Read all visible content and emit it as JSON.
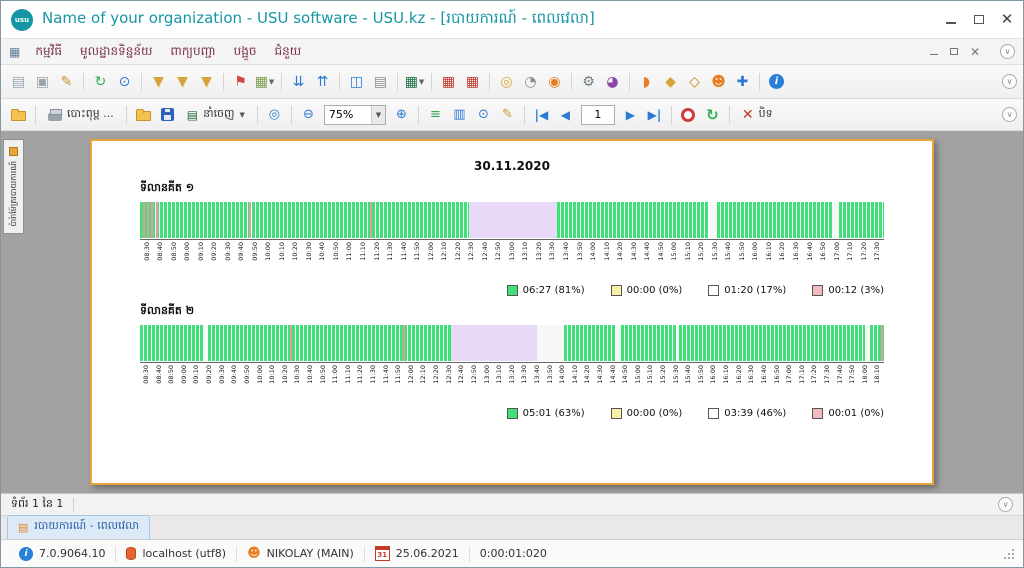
{
  "window": {
    "logo_text": "usu",
    "title": "Name of your organization - USU software - USU.kz - [របាយការណ៍ - ពេលវេលា]"
  },
  "menu": {
    "items": [
      "កម្មវិធី",
      "មូលដ្ឋានទិន្នន័យ",
      "ពាក្យបញ្ជា",
      "បង្អួច",
      "ជំនួយ"
    ]
  },
  "toolbar_main": {
    "icons": [
      {
        "name": "new-record-icon",
        "glyph": "▤",
        "color": "#98a4ae"
      },
      {
        "name": "copy-record-icon",
        "glyph": "▣",
        "color": "#98a4ae"
      },
      {
        "name": "edit-record-icon",
        "glyph": "✎",
        "color": "#c8952e"
      },
      {
        "sep": true
      },
      {
        "name": "refresh-data-icon",
        "glyph": "↻",
        "color": "#2faf4f"
      },
      {
        "name": "search-icon",
        "glyph": "⊙",
        "color": "#2b7bd5"
      },
      {
        "sep": true
      },
      {
        "name": "filter-icon",
        "glyph": "▼",
        "color": "#d5a33a"
      },
      {
        "name": "filter-add-icon",
        "glyph": "▼",
        "color": "#d5a33a"
      },
      {
        "name": "filter-clear-icon",
        "glyph": "▼",
        "color": "#d5a33a"
      },
      {
        "sep": true
      },
      {
        "name": "flag-icon",
        "glyph": "⚑",
        "color": "#d04545"
      },
      {
        "name": "image-icon",
        "glyph": "▦",
        "color": "#7a9e4f",
        "dropdown": true
      },
      {
        "sep": true
      },
      {
        "name": "expand-all-icon",
        "glyph": "⇊",
        "color": "#2b7bd5"
      },
      {
        "name": "collapse-all-icon",
        "glyph": "⇈",
        "color": "#2b7bd5"
      },
      {
        "sep": true
      },
      {
        "name": "add-tab-icon",
        "glyph": "◫",
        "color": "#2b7bd5"
      },
      {
        "name": "notebook-icon",
        "glyph": "▤",
        "color": "#8a8f94"
      },
      {
        "sep": true
      },
      {
        "name": "excel-export-icon",
        "glyph": "▦",
        "color": "#1d7044",
        "dropdown": true
      },
      {
        "sep": true
      },
      {
        "name": "report-date-icon",
        "glyph": "▦",
        "color": "#c0392b"
      },
      {
        "name": "calendar-icon",
        "glyph": "▦",
        "color": "#c0392b"
      },
      {
        "sep": true
      },
      {
        "name": "money-icon",
        "glyph": "◎",
        "color": "#d5a33a"
      },
      {
        "name": "history-icon",
        "glyph": "◔",
        "color": "#8a8f94"
      },
      {
        "name": "map-pin-icon",
        "glyph": "◉",
        "color": "#e67e22"
      },
      {
        "sep": true
      },
      {
        "name": "settings-gear-icon",
        "glyph": "⚙",
        "color": "#6f7b85"
      },
      {
        "name": "globe-icon",
        "glyph": "◕",
        "color": "#8e44ad"
      },
      {
        "sep": true
      },
      {
        "name": "rss-icon",
        "glyph": "◗",
        "color": "#e67e22"
      },
      {
        "name": "lock-icon",
        "glyph": "◆",
        "color": "#d5a33a"
      },
      {
        "name": "key-icon",
        "glyph": "◇",
        "color": "#b8860b"
      },
      {
        "name": "users-icon",
        "glyph": "☻",
        "color": "#e67e22"
      },
      {
        "name": "tools-icon",
        "glyph": "✚",
        "color": "#2b7bd5"
      },
      {
        "sep": true
      },
      {
        "name": "help-info-icon",
        "glyph": "i",
        "color": "#ffffff",
        "bg": "#2980d9",
        "circle": true
      }
    ]
  },
  "preview_toolbar": {
    "print_label": "បោះពុម្ព ...",
    "export_label": "នាំចេញ",
    "zoom_value": "75%",
    "page_value": "1",
    "close_label": "បិទ"
  },
  "side_tab": {
    "label": "ប៉ារ៉ាម៉ែត្ររបាយការណ៍"
  },
  "report": {
    "date_title": "30.11.2020",
    "page_info": "ទំព័រ 1 នៃ 1"
  },
  "tabs": {
    "items": [
      {
        "label": "របាយការណ៍ - ពេលវេលា",
        "active": true
      }
    ]
  },
  "statusbar": {
    "version": "7.0.9064.10",
    "database": "localhost (utf8)",
    "user": "NIKOLAY (MAIN)",
    "calendar_day": "31",
    "date": "25.06.2021",
    "timer": "0:00:01:020"
  },
  "colors": {
    "accent_teal": "#1496a5",
    "page_border": "#e8a33d",
    "active_green": "#3fe178",
    "pause_lavender": "#e9d9f8",
    "legend_yellow": "#f7f2a6",
    "legend_pink": "#f5b9c0"
  },
  "chart_data": [
    {
      "type": "timeline",
      "title": "ទីលានគីត ១",
      "x_start": "08:30",
      "x_end": "17:30",
      "tick_interval_minutes": 10,
      "ticks": [
        "08:30",
        "08:40",
        "08:50",
        "09:00",
        "09:10",
        "09:20",
        "09:30",
        "09:40",
        "09:50",
        "10:00",
        "10:10",
        "10:20",
        "10:30",
        "10:40",
        "10:50",
        "11:00",
        "11:10",
        "11:20",
        "11:30",
        "11:40",
        "11:50",
        "12:00",
        "12:10",
        "12:20",
        "12:30",
        "12:40",
        "12:50",
        "13:00",
        "13:10",
        "13:20",
        "13:30",
        "13:40",
        "13:50",
        "14:00",
        "14:10",
        "14:20",
        "14:30",
        "14:40",
        "14:50",
        "15:00",
        "15:10",
        "15:20",
        "15:30",
        "15:40",
        "15:50",
        "16:00",
        "16:10",
        "16:20",
        "16:30",
        "16:40",
        "16:50",
        "17:00",
        "17:10",
        "17:20",
        "17:30"
      ],
      "segments": [
        {
          "kind": "active",
          "from_pct": 0,
          "to_pct": 44.2
        },
        {
          "kind": "pause",
          "from_pct": 44.2,
          "to_pct": 56.1
        },
        {
          "kind": "active",
          "from_pct": 56.1,
          "to_pct": 76.5
        },
        {
          "kind": "gap",
          "from_pct": 76.5,
          "to_pct": 77.6
        },
        {
          "kind": "active",
          "from_pct": 77.6,
          "to_pct": 93.0
        },
        {
          "kind": "gap",
          "from_pct": 93.0,
          "to_pct": 94.0
        },
        {
          "kind": "active",
          "from_pct": 94.0,
          "to_pct": 100
        }
      ],
      "pink_stripes_pct": [
        0.4,
        0.9,
        1.5,
        2.1,
        14.6,
        30.9
      ],
      "legend": [
        {
          "color": "#3fe178",
          "label": "06:27 (81%)"
        },
        {
          "color": "#f7f2a6",
          "label": "00:00 (0%)"
        },
        {
          "color": "#ffffff",
          "label": "01:20 (17%)"
        },
        {
          "color": "#f5b9c0",
          "label": "00:12 (3%)"
        }
      ]
    },
    {
      "type": "timeline",
      "title": "ទីលានគីត ២",
      "x_start": "08:30",
      "x_end": "18:10",
      "tick_interval_minutes": 10,
      "ticks": [
        "08:30",
        "08:40",
        "08:50",
        "09:00",
        "09:10",
        "09:20",
        "09:30",
        "09:40",
        "09:50",
        "10:00",
        "10:10",
        "10:20",
        "10:30",
        "10:40",
        "10:50",
        "11:00",
        "11:10",
        "11:20",
        "11:30",
        "11:40",
        "11:50",
        "12:00",
        "12:10",
        "12:20",
        "12:30",
        "12:40",
        "12:50",
        "13:00",
        "13:10",
        "13:20",
        "13:30",
        "13:40",
        "13:50",
        "14:00",
        "14:10",
        "14:20",
        "14:30",
        "14:40",
        "14:50",
        "15:00",
        "15:10",
        "15:20",
        "15:30",
        "15:40",
        "15:50",
        "16:00",
        "16:10",
        "16:20",
        "16:30",
        "16:40",
        "16:50",
        "17:00",
        "17:10",
        "17:20",
        "17:30",
        "17:40",
        "17:50",
        "18:00",
        "18:10"
      ],
      "segments": [
        {
          "kind": "active",
          "from_pct": 0,
          "to_pct": 8.6
        },
        {
          "kind": "gap",
          "from_pct": 8.6,
          "to_pct": 9.2
        },
        {
          "kind": "active",
          "from_pct": 9.2,
          "to_pct": 41.8
        },
        {
          "kind": "pause",
          "from_pct": 41.8,
          "to_pct": 53.3
        },
        {
          "kind": "gap",
          "from_pct": 53.3,
          "to_pct": 57.0
        },
        {
          "kind": "active",
          "from_pct": 57.0,
          "to_pct": 64.0
        },
        {
          "kind": "gap",
          "from_pct": 64.0,
          "to_pct": 64.6
        },
        {
          "kind": "active",
          "from_pct": 64.6,
          "to_pct": 72.0
        },
        {
          "kind": "gap",
          "from_pct": 72.0,
          "to_pct": 72.5
        },
        {
          "kind": "active",
          "from_pct": 72.5,
          "to_pct": 97.5
        },
        {
          "kind": "gap",
          "from_pct": 97.5,
          "to_pct": 98.1
        },
        {
          "kind": "active",
          "from_pct": 98.1,
          "to_pct": 100
        }
      ],
      "pink_stripes_pct": [
        20.2,
        35.3,
        99.6
      ],
      "legend": [
        {
          "color": "#3fe178",
          "label": "05:01 (63%)"
        },
        {
          "color": "#f7f2a6",
          "label": "00:00 (0%)"
        },
        {
          "color": "#ffffff",
          "label": "03:39 (46%)"
        },
        {
          "color": "#f5b9c0",
          "label": "00:01 (0%)"
        }
      ]
    }
  ]
}
